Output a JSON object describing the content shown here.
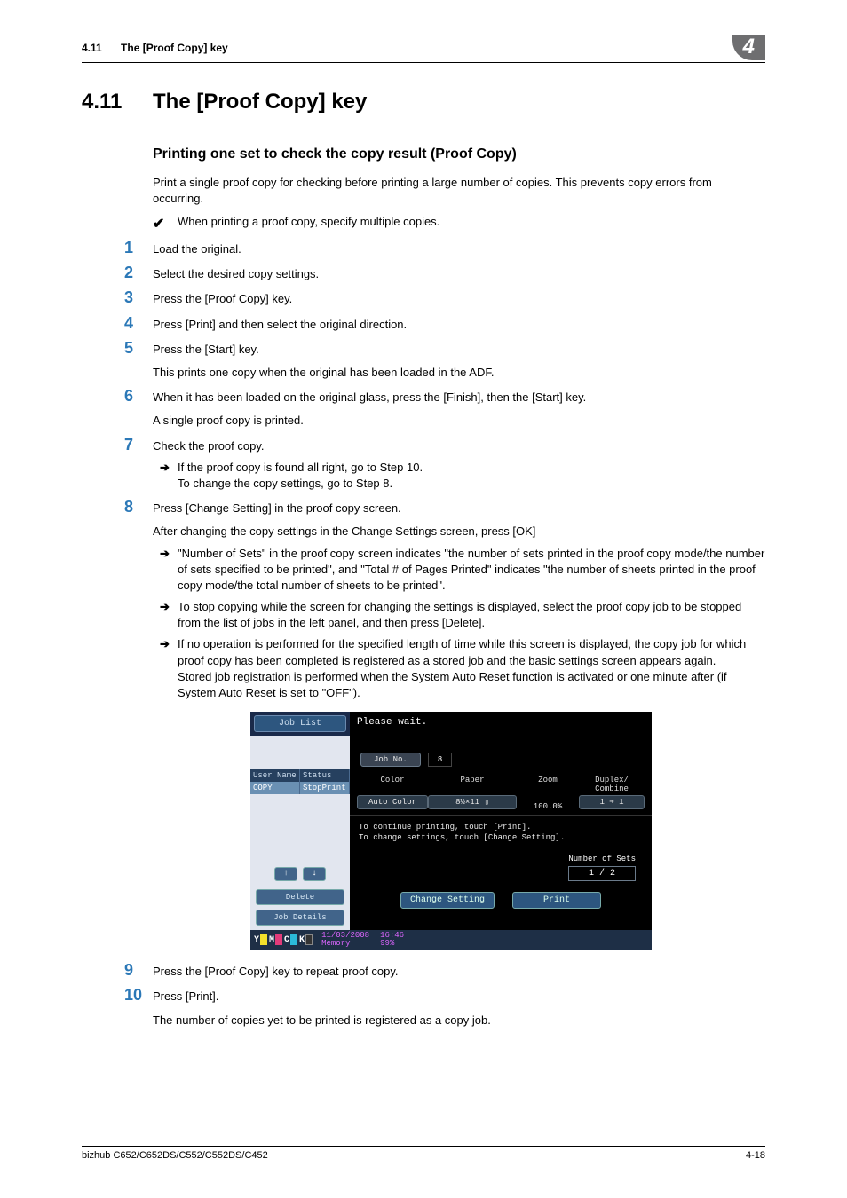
{
  "running_head": {
    "section_number": "4.11",
    "section_title": "The [Proof Copy] key",
    "chapter_number": "4"
  },
  "h1": {
    "number": "4.11",
    "title": "The [Proof Copy] key"
  },
  "h2": "Printing one set to check the copy result (Proof Copy)",
  "intro": "Print a single proof copy for checking before printing a large number of copies. This prevents copy errors from occurring.",
  "checkmark": "✔",
  "check_note": "When printing a proof copy, specify multiple copies.",
  "steps": {
    "s1": {
      "num": "1",
      "text": "Load the original."
    },
    "s2": {
      "num": "2",
      "text": "Select the desired copy settings."
    },
    "s3": {
      "num": "3",
      "text": "Press the [Proof Copy] key."
    },
    "s4": {
      "num": "4",
      "text": "Press [Print] and then select the original direction."
    },
    "s5": {
      "num": "5",
      "text": "Press the [Start] key.",
      "sub": "This prints one copy when the original has been loaded in the ADF."
    },
    "s6": {
      "num": "6",
      "text": "When it has been loaded on the original glass, press the [Finish], then the [Start] key.",
      "sub": "A single proof copy is printed."
    },
    "s7": {
      "num": "7",
      "text": "Check the proof copy.",
      "arrow": "➔",
      "b1": "If the proof copy is found all right, go to Step 10.\nTo change the copy settings, go to Step 8."
    },
    "s8": {
      "num": "8",
      "text": "Press [Change Setting] in the proof copy screen.",
      "sub": "After changing the copy settings in the Change Settings screen, press [OK]",
      "arrow": "➔",
      "b1": "\"Number of Sets\" in the proof copy screen indicates \"the number of sets printed in the proof copy mode/the number of sets specified to be printed\", and \"Total # of Pages Printed\" indicates \"the number of sheets printed in the proof copy mode/the total number of sheets to be printed\".",
      "b2": "To stop copying while the screen for changing the settings is displayed, select the proof copy job to be stopped from the list of jobs in the left panel, and then press [Delete].",
      "b3": "If no operation is performed for the specified length of time while this screen is displayed, the copy job for which proof copy has been completed is registered as a stored job and the basic settings screen appears again.\nStored job registration is performed when the System Auto Reset function is activated or one minute after (if System Auto Reset is set to \"OFF\")."
    },
    "s9": {
      "num": "9",
      "text": "Press the [Proof Copy] key to repeat proof copy."
    },
    "s10": {
      "num": "10",
      "text": "Press [Print].",
      "sub": "The number of copies yet to be printed is registered as a copy job."
    }
  },
  "screenshot": {
    "job_list_tab": "Job List",
    "hdr_user": "User Name",
    "hdr_status": "Status",
    "row_user": "COPY",
    "row_status": "StopPrint",
    "arrow_up": "↑",
    "arrow_down": "↓",
    "delete_btn": "Delete",
    "job_details_btn": "Job Details",
    "please_wait": "Please wait.",
    "job_no_label": "Job No.",
    "job_no_value": "8",
    "col_color": "Color",
    "col_paper": "Paper",
    "col_zoom": "Zoom",
    "col_duplex": "Duplex/\nCombine",
    "val_color": "Auto Color",
    "val_paper": "8½×11 ▯",
    "val_zoom": "100.0%",
    "val_duplex": "1 ➜ 1",
    "instr1": "To continue printing, touch [Print].",
    "instr2": "To change settings, touch [Change Setting].",
    "num_sets_label": "Number of Sets",
    "num_sets_value": "1 / 2",
    "change_setting_btn": "Change Setting",
    "print_btn": "Print",
    "toner": {
      "y": "Y",
      "m": "M",
      "c": "C",
      "k": "K"
    },
    "footer_date": "11/03/2008",
    "footer_time": "16:46",
    "footer_mem_label": "Memory",
    "footer_mem_value": "99%"
  },
  "footer": {
    "product": "bizhub C652/C652DS/C552/C552DS/C452",
    "page": "4-18"
  }
}
